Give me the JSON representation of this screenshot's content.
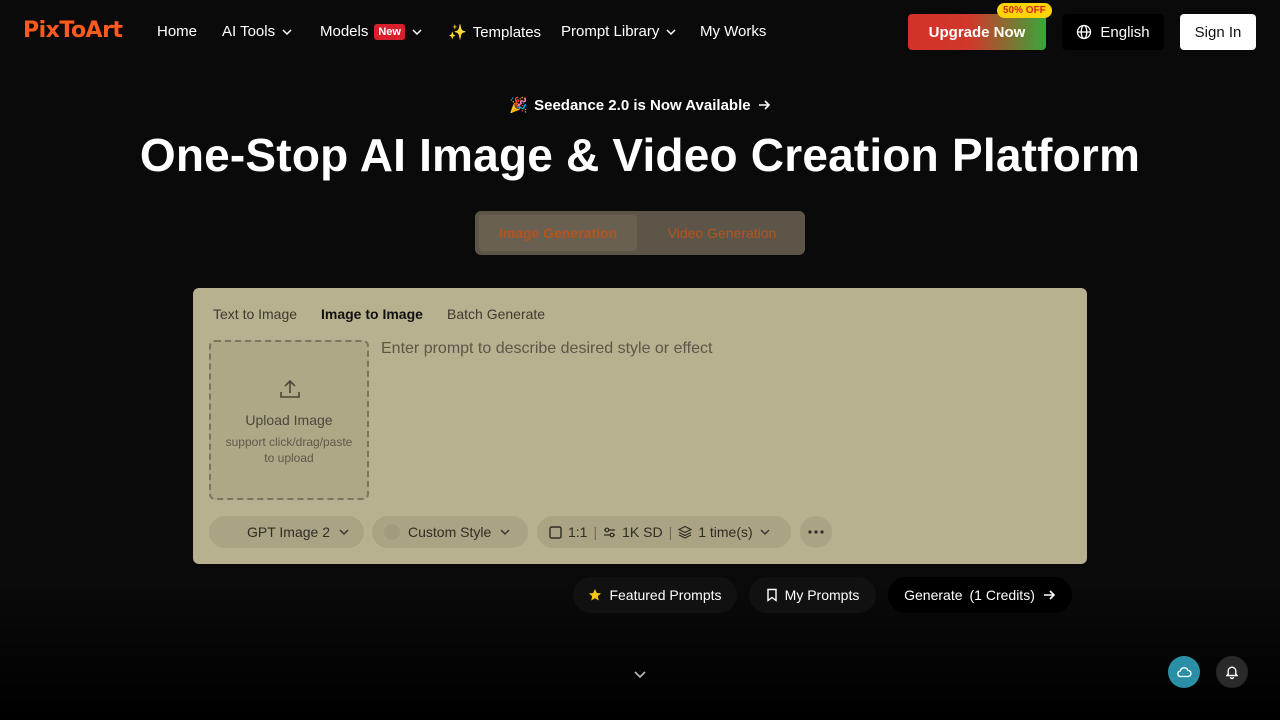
{
  "brand": {
    "logo_text": "PixToArt",
    "accent": "#ff5a1f"
  },
  "nav": {
    "items": [
      {
        "label": "Home"
      },
      {
        "label": "AI Tools",
        "icon": "chevron-down-icon"
      },
      {
        "label": "Models",
        "badge": "New",
        "icon": "chevron-down-icon"
      },
      {
        "label": "Templates",
        "prefix_icon": "sparkles-icon",
        "prefix_glyph": "✨"
      },
      {
        "label": "Prompt Library",
        "icon": "chevron-down-icon"
      },
      {
        "label": "My Works"
      }
    ],
    "upgrade_label": "Upgrade Now",
    "discount_badge": "50% OFF",
    "language_label": "English",
    "signin_label": "Sign In"
  },
  "hero": {
    "announcement_emoji": "🎉",
    "announcement": "Seedance 2.0 is Now Available",
    "title": "One-Stop AI Image & Video Creation Platform",
    "modes": [
      {
        "label": "Image Generation",
        "active": true
      },
      {
        "label": "Video Generation",
        "active": false
      }
    ]
  },
  "panel": {
    "tabs": [
      {
        "label": "Text to Image",
        "active": false
      },
      {
        "label": "Image to Image",
        "active": true
      },
      {
        "label": "Batch Generate",
        "active": false
      }
    ],
    "upload": {
      "title": "Upload Image",
      "subtitle": "support click/drag/paste to upload"
    },
    "prompt_placeholder": "Enter prompt to describe desired style or effect",
    "model_label": "GPT Image 2",
    "style_label": "Custom Style",
    "aspect_ratio": "1:1",
    "resolution": "1K SD",
    "count": "1 time(s)",
    "panel_color": "#b7b18f"
  },
  "actions": {
    "featured_label": "Featured Prompts",
    "my_prompts_label": "My Prompts",
    "generate_label": "Generate",
    "generate_credits": "1 Credits"
  }
}
